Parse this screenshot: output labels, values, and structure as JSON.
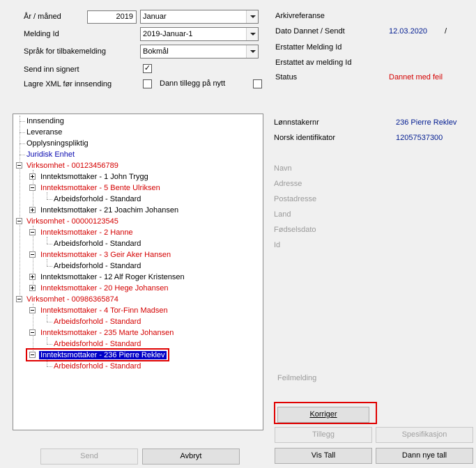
{
  "form": {
    "year_month_label": "År / måned",
    "year_value": "2019",
    "month_value": "Januar",
    "melding_id_label": "Melding Id",
    "melding_id_value": "2019-Januar-1",
    "language_label": "Språk for tilbakemelding",
    "language_value": "Bokmål",
    "send_signed_label": "Send inn signert",
    "send_signed_checked": "✓",
    "save_xml_label": "Lagre XML før innsending",
    "create_attachment_label": "Dann tillegg på nytt"
  },
  "info": {
    "arkivreferanse_label": "Arkivreferanse",
    "dato_label": "Dato  Dannet / Sendt",
    "dato_value": "12.03.2020",
    "dato_sep": "/",
    "erstatter_label": "Erstatter Melding Id",
    "erstattet_av_label": "Erstattet av melding Id",
    "status_label": "Status",
    "status_value": "Dannet med feil",
    "status_color": "#d40000"
  },
  "tree": {
    "items": [
      "Innsending",
      "Leveranse",
      "Opplysningspliktig",
      "Juridisk Enhet",
      "Virksomhet - 00123456789",
      "Inntektsmottaker - 1 John Trygg",
      "Inntektsmottaker - 5 Bente Ulriksen",
      "Arbeidsforhold - Standard",
      "Inntektsmottaker - 21 Joachim Johansen",
      "Virksomhet - 00000123545",
      "Inntektsmottaker - 2 Hanne",
      "Arbeidsforhold - Standard",
      "Inntektsmottaker - 3 Geir Aker Hansen",
      "Arbeidsforhold - Standard",
      "Inntektsmottaker - 12 Alf Roger Kristensen",
      "Inntektsmottaker - 20 Hege Johansen",
      "Virksomhet - 00986365874",
      "Inntektsmottaker - 4 Tor-Finn Madsen",
      "Arbeidsforhold - Standard",
      "Inntektsmottaker - 235 Marte Johansen",
      "Arbeidsforhold - Standard",
      "Inntektsmottaker - 236 Pierre Reklev",
      "Arbeidsforhold - Standard"
    ],
    "selected_item": "Inntektsmottaker - 236 Pierre Reklev"
  },
  "details": {
    "lonnstakernr_label": "Lønnstakernr",
    "lonnstakernr_value": "236  Pierre Reklev",
    "norsk_id_label": "Norsk identifikator",
    "norsk_id_value": "12057537300",
    "navn_label": "Navn",
    "adresse_label": "Adresse",
    "postadresse_label": "Postadresse",
    "land_label": "Land",
    "fodselsdato_label": "Fødselsdato",
    "id_label": "Id",
    "feilmelding_label": "Feilmelding"
  },
  "buttons": {
    "korriger": "Korriger",
    "tillegg": "Tillegg",
    "spesifikasjon": "Spesifikasjon",
    "send": "Send",
    "avbryt": "Avbryt",
    "vis_tall": "Vis Tall",
    "dann_nye_tall": "Dann nye tall"
  },
  "colors": {
    "highlight_box": "#e00000",
    "selection": "#0000c8"
  }
}
